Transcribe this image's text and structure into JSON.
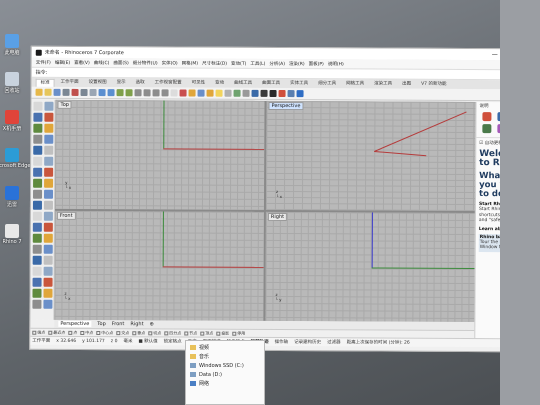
{
  "desktop": {
    "icons": [
      {
        "label": "此电脑",
        "color": "#5aa0e6"
      },
      {
        "label": "回收站",
        "color": "#c9d3de"
      },
      {
        "label": "X机手册",
        "color": "#e0443a"
      },
      {
        "label": "Microsoft Edge",
        "color": "#2c9cd6"
      },
      {
        "label": "迅雷",
        "color": "#2a72d8"
      },
      {
        "label": "Rhino 7",
        "color": "#e8e8e8"
      }
    ]
  },
  "window": {
    "title": "未命名 - Rhinoceros 7 Corporate",
    "controls": [
      "—",
      "☐",
      "✕"
    ]
  },
  "menubar": {
    "items": [
      "文件(F)",
      "编辑(E)",
      "查看(V)",
      "曲线(C)",
      "曲面(S)",
      "细分物件(U)",
      "实体(O)",
      "网格(M)",
      "尺寸标注(D)",
      "变动(T)",
      "工具(L)",
      "分析(A)",
      "渲染(R)",
      "面板(P)",
      "说明(H)"
    ]
  },
  "command": {
    "label": "指令:",
    "placeholder": ""
  },
  "tabs": {
    "items": [
      "标准",
      "工作平面",
      "设置视图",
      "显示",
      "选取",
      "工作视窗配置",
      "可见性",
      "变动",
      "曲线工具",
      "曲面工具",
      "实体工具",
      "细分工具",
      "网格工具",
      "渲染工具",
      "出图",
      "V7 的新功能"
    ],
    "active_index": 0
  },
  "toolbar": {
    "icons": [
      "new-icon",
      "open-icon",
      "save-icon",
      "print-icon",
      "cut-icon",
      "copy-icon",
      "paste-icon",
      "undo-icon",
      "redo-icon",
      "pan-icon",
      "rotate-view-icon",
      "zoom-icon",
      "zoom-window-icon",
      "zoom-extents-icon",
      "zoom-selected-icon",
      "select-icon",
      "move-icon",
      "copy-object-icon",
      "layer-icon",
      "properties-icon",
      "bulb-icon",
      "lock-icon",
      "cplane-icon",
      "shade-icon",
      "render-icon",
      "material-icon",
      "sphere-icon",
      "display-icon",
      "options-icon",
      "help-icon"
    ],
    "colors": [
      "#e6b84a",
      "#e6c65c",
      "#6a8fc9",
      "#7b8794",
      "#c0504d",
      "#7b8794",
      "#9aa6b4",
      "#5b8fd0",
      "#5b8fd0",
      "#7fa04a",
      "#7fa04a",
      "#8d8d8d",
      "#8d8d8d",
      "#8d8d8d",
      "#8d8d8d",
      "#dcdcdc",
      "#c94f4f",
      "#e0a63a",
      "#6a8fc9",
      "#e0a63a",
      "#f2d45c",
      "#b0b0b0",
      "#6fa36f",
      "#9a9a9a",
      "#3a6aa8",
      "#3a3a3a",
      "#2a2a2a",
      "#d04f3b",
      "#5a7fb0",
      "#2f6dc4"
    ]
  },
  "viewports": [
    {
      "label": "Top",
      "active": false
    },
    {
      "label": "Perspective",
      "active": true
    },
    {
      "label": "Front",
      "active": false
    },
    {
      "label": "Right",
      "active": false
    }
  ],
  "viewport_tabs": [
    "Perspective",
    "Top",
    "Front",
    "Right",
    "⊕"
  ],
  "osnap": {
    "items": [
      "端点",
      "最近点",
      "点",
      "中点",
      "中心点",
      "交点",
      "垂点",
      "切点",
      "四分点",
      "节点",
      "顶点",
      "投影",
      "停用"
    ]
  },
  "statusbar": {
    "items": [
      {
        "text": "工作平面",
        "bold": false
      },
      {
        "text": "x 32.646",
        "bold": false
      },
      {
        "text": "y 101.177",
        "bold": false
      },
      {
        "text": "z 0",
        "bold": false
      },
      {
        "text": "毫米",
        "bold": false
      },
      {
        "text": "■ 默认值",
        "bold": false
      },
      {
        "text": "锁定格点",
        "bold": false
      },
      {
        "text": "正交",
        "bold": false
      },
      {
        "text": "平面模式",
        "bold": false
      },
      {
        "text": "物件锁点",
        "bold": false
      },
      {
        "text": "智慧轨迹",
        "bold": true
      },
      {
        "text": "操作轴",
        "bold": false
      },
      {
        "text": "记录建构历史",
        "bold": false
      },
      {
        "text": "过滤器",
        "bold": false
      },
      {
        "text": "距离上次保存的时间 (分钟): 26",
        "bold": false
      }
    ]
  },
  "right_panel": {
    "header": "说明",
    "icons": [
      "#d04f3b",
      "#3a6aa8",
      "#e0a63a",
      "#4a7a4a",
      "#a45ab8",
      "#5a7fb0"
    ],
    "autoexpand": "☑ 自动更新",
    "welcome": "Welcome to Rhino",
    "what": "What do you want to do?",
    "start_title": "Start Rhino",
    "start_text": "Start Rhino with shortcuts, schemes, and \"safe mode\"",
    "learn_title": "Learn about Rhino",
    "basics_title": "Rhino basics",
    "basics_text": "Tour the Rhino Window Navigate in"
  },
  "explorer": {
    "items": [
      {
        "label": "视频",
        "kind": "folder"
      },
      {
        "label": "音乐",
        "kind": "folder"
      },
      {
        "label": "Windows SSD (C:)",
        "kind": "drive"
      },
      {
        "label": "Data (D:)",
        "kind": "drive"
      },
      {
        "label": "网络",
        "kind": "blue"
      }
    ]
  }
}
